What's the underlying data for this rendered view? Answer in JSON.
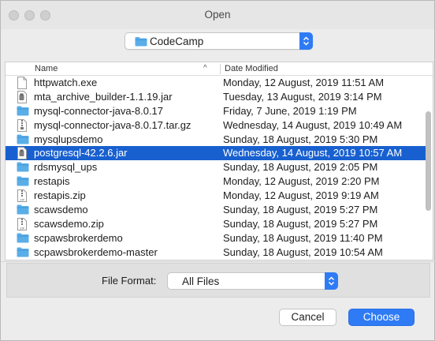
{
  "window": {
    "title": "Open"
  },
  "location": {
    "selected": "CodeCamp",
    "icon": "folder-icon"
  },
  "columns": {
    "name": "Name",
    "date": "Date Modified"
  },
  "files": [
    {
      "name": "httpwatch.exe",
      "date": "Monday, 12 August, 2019 11:51 AM",
      "icon": "blank-file-icon",
      "selected": false
    },
    {
      "name": "mta_archive_builder-1.1.19.jar",
      "date": "Tuesday, 13 August, 2019 3:14 PM",
      "icon": "jar-file-icon",
      "selected": false
    },
    {
      "name": "mysql-connector-java-8.0.17",
      "date": "Friday, 7 June, 2019 1:19 PM",
      "icon": "folder-icon",
      "selected": false
    },
    {
      "name": "mysql-connector-java-8.0.17.tar.gz",
      "date": "Wednesday, 14 August, 2019 10:49 AM",
      "icon": "archive-file-icon",
      "selected": false
    },
    {
      "name": "mysqlupsdemo",
      "date": "Sunday, 18 August, 2019 5:30 PM",
      "icon": "folder-icon",
      "selected": false
    },
    {
      "name": "postgresql-42.2.6.jar",
      "date": "Wednesday, 14 August, 2019 10:57 AM",
      "icon": "jar-file-icon",
      "selected": true
    },
    {
      "name": "rdsmysql_ups",
      "date": "Sunday, 18 August, 2019 2:05 PM",
      "icon": "folder-icon",
      "selected": false
    },
    {
      "name": "restapis",
      "date": "Monday, 12 August, 2019 2:20 PM",
      "icon": "folder-icon",
      "selected": false
    },
    {
      "name": "restapis.zip",
      "date": "Monday, 12 August, 2019 9:19 AM",
      "icon": "zip-file-icon",
      "selected": false
    },
    {
      "name": "scawsdemo",
      "date": "Sunday, 18 August, 2019 5:27 PM",
      "icon": "folder-icon",
      "selected": false
    },
    {
      "name": "scawsdemo.zip",
      "date": "Sunday, 18 August, 2019 5:27 PM",
      "icon": "zip-file-icon",
      "selected": false
    },
    {
      "name": "scpawsbrokerdemo",
      "date": "Sunday, 18 August, 2019 11:40 PM",
      "icon": "folder-icon",
      "selected": false
    },
    {
      "name": "scpawsbrokerdemo-master",
      "date": "Sunday, 18 August, 2019 10:54 AM",
      "icon": "folder-icon",
      "selected": false
    }
  ],
  "format": {
    "label": "File Format:",
    "selected": "All Files"
  },
  "buttons": {
    "cancel": "Cancel",
    "choose": "Choose"
  },
  "colors": {
    "accent": "#2f7bf5",
    "selection": "#1860cf",
    "folder": "#5aaee8"
  }
}
